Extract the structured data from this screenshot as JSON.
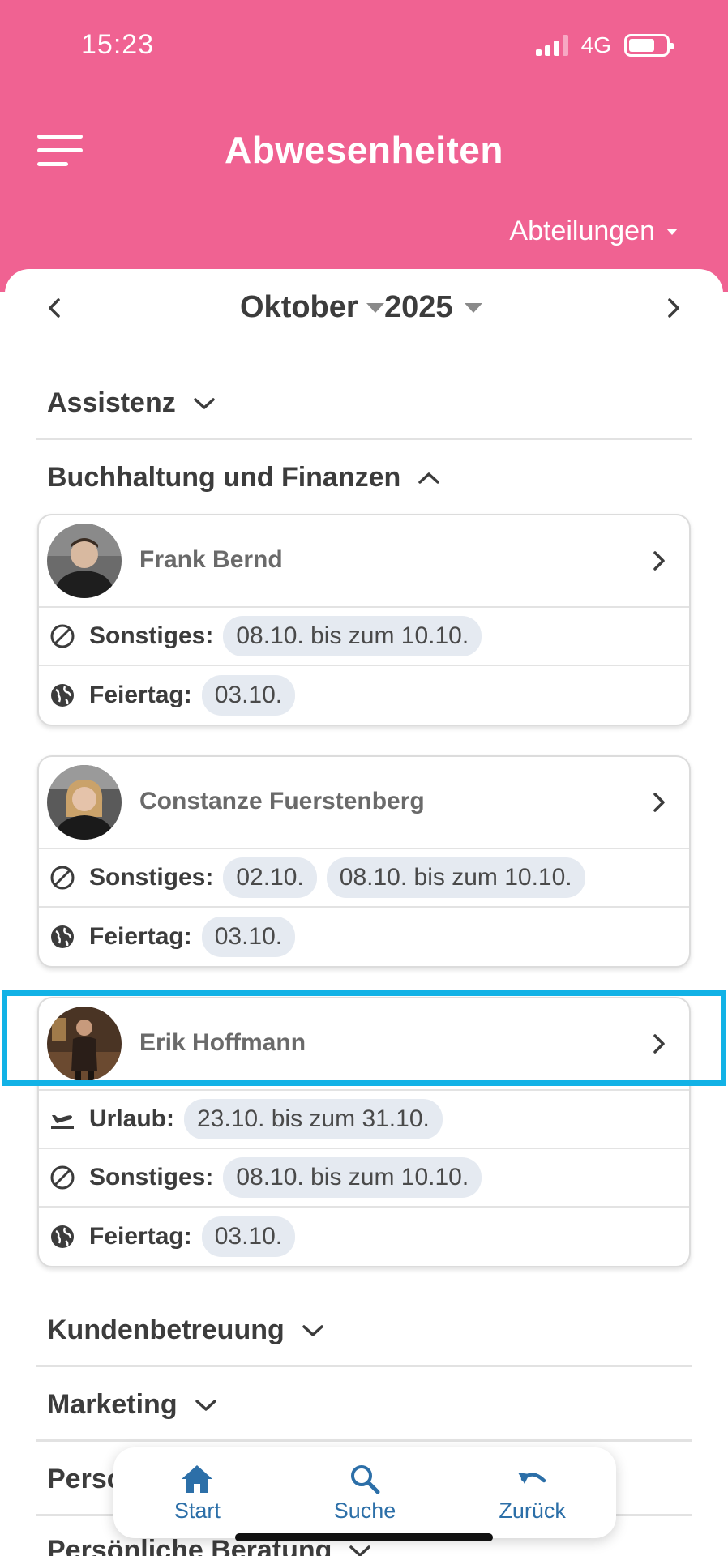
{
  "status_bar": {
    "time": "15:23",
    "network": "4G"
  },
  "header": {
    "title": "Abwesenheiten",
    "department_filter": "Abteilungen"
  },
  "month_nav": {
    "month": "Oktober",
    "year": "2025"
  },
  "sections": [
    {
      "title": "Assistenz",
      "expanded": false
    },
    {
      "title": "Buchhaltung und Finanzen",
      "expanded": true
    },
    {
      "title": "Kundenbetreuung",
      "expanded": false
    },
    {
      "title": "Marketing",
      "expanded": false
    },
    {
      "title": "Perso",
      "expanded": false
    },
    {
      "title": "Persönliche Beratung",
      "expanded": false
    }
  ],
  "people": [
    {
      "name": "Frank Bernd",
      "rows": [
        {
          "icon": "block-icon",
          "label": "Sonstiges:",
          "chips": [
            "08.10. bis zum 10.10."
          ]
        },
        {
          "icon": "globe-icon",
          "label": "Feiertag:",
          "chips": [
            "03.10."
          ]
        }
      ]
    },
    {
      "name": "Constanze Fuerstenberg",
      "rows": [
        {
          "icon": "block-icon",
          "label": "Sonstiges:",
          "chips": [
            "02.10.",
            "08.10. bis zum 10.10."
          ]
        },
        {
          "icon": "globe-icon",
          "label": "Feiertag:",
          "chips": [
            "03.10."
          ]
        }
      ]
    },
    {
      "name": "Erik Hoffmann",
      "rows": [
        {
          "icon": "flight-icon",
          "label": "Urlaub:",
          "chips": [
            "23.10. bis zum 31.10."
          ]
        },
        {
          "icon": "block-icon",
          "label": "Sonstiges:",
          "chips": [
            "08.10. bis zum 10.10."
          ]
        },
        {
          "icon": "globe-icon",
          "label": "Feiertag:",
          "chips": [
            "03.10."
          ]
        }
      ]
    }
  ],
  "bottom_nav": {
    "home": "Start",
    "search": "Suche",
    "back": "Zurück"
  },
  "colors": {
    "header": "#f06292",
    "chip": "#e5eaf1",
    "nav": "#2c6fa8",
    "highlight": "#12b2e6"
  }
}
